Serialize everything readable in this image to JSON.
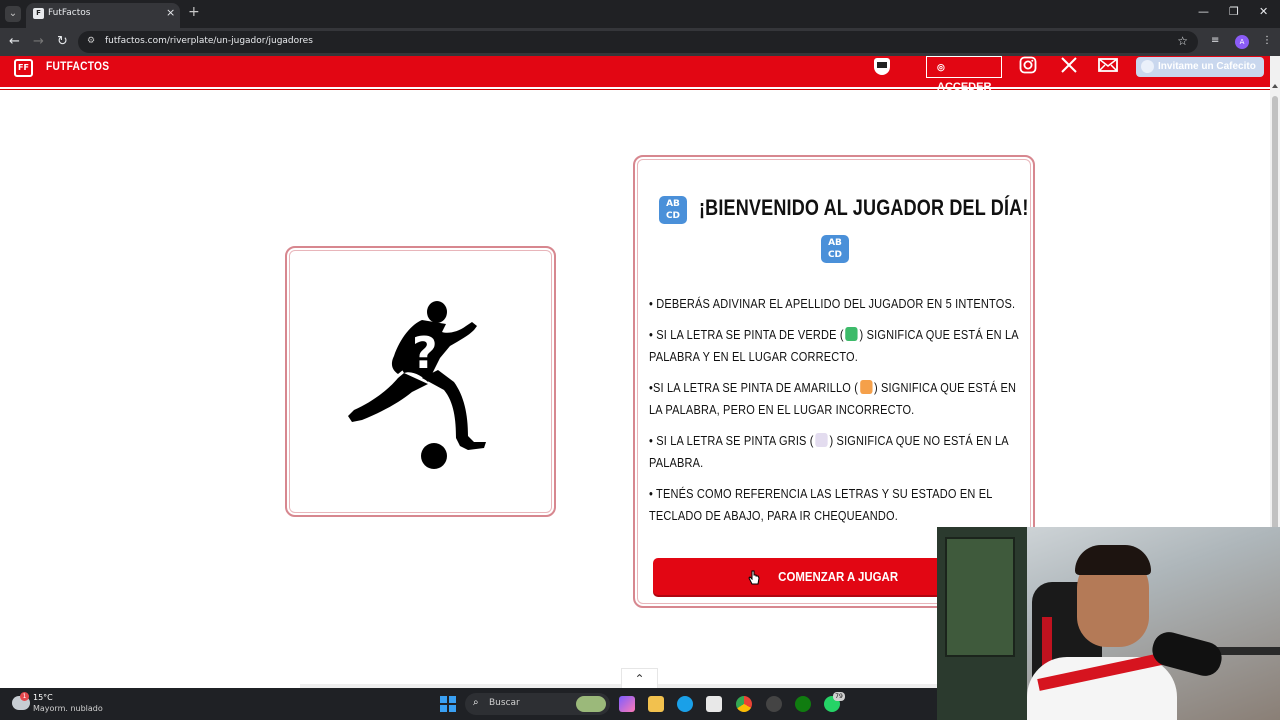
{
  "browser": {
    "tab_title": "FutFactos",
    "tab_close": "×",
    "new_tab": "+",
    "url": "futfactos.com/riverplate/un-jugador/jugadores",
    "profile_initial": "A"
  },
  "header": {
    "brand": "FUTFACTOS",
    "login_label": "ACCEDER",
    "cafecito_label": "Invitame un Cafecito"
  },
  "welcome": {
    "title": "¡BIENVENIDO AL JUGADOR DEL DÍA!",
    "abcd_glyph": "AB CD",
    "rules": {
      "r1": "• DEBERÁS ADIVINAR EL APELLIDO DEL JUGADOR EN 5 INTENTOS.",
      "r2a": "• SI LA LETRA SE PINTA DE VERDE (",
      "r2b": ") SIGNIFICA QUE ESTÁ EN LA PALABRA Y EN EL LUGAR CORRECTO.",
      "r3a": "•SI LA LETRA SE PINTA DE AMARILLO (",
      "r3b": ") SIGNIFICA QUE ESTÁ EN LA PALABRA, PERO EN EL LUGAR INCORRECTO.",
      "r4a": "• SI LA LETRA SE PINTA GRIS (",
      "r4b": ") SIGNIFICA QUE NO ESTÁ EN LA PALABRA.",
      "r5": "• TENÉS COMO REFERENCIA LAS LETRAS Y SU ESTADO EN EL TECLADO DE ABAJO, PARA IR CHEQUEANDO."
    },
    "start_button": "COMENZAR A JUGAR"
  },
  "colors": {
    "brand_red": "#e20613",
    "green_square": "#3dbb6a",
    "orange_square": "#f5a04a",
    "gray_square": "#e3dcef",
    "abcd_blue": "#4a90d9"
  },
  "taskbar": {
    "weather_temp": "15°C",
    "weather_desc": "Mayorm. nublado",
    "weather_badge": "1",
    "search_placeholder": "Buscar",
    "whatsapp_badge": "79"
  },
  "icons": [
    "tab-menu-icon",
    "favicon-icon",
    "back-icon",
    "forward-icon",
    "reload-icon",
    "site-info-icon",
    "star-icon",
    "extensions-icon",
    "menu-dots-icon",
    "logo-icon",
    "club-crest-icon",
    "user-icon",
    "instagram-icon",
    "x-icon",
    "mail-icon",
    "coffee-icon",
    "abcd-icon",
    "player-silhouette-icon",
    "cursor-icon",
    "scroll-top-icon",
    "weather-icon",
    "windows-start-icon",
    "search-icon"
  ]
}
